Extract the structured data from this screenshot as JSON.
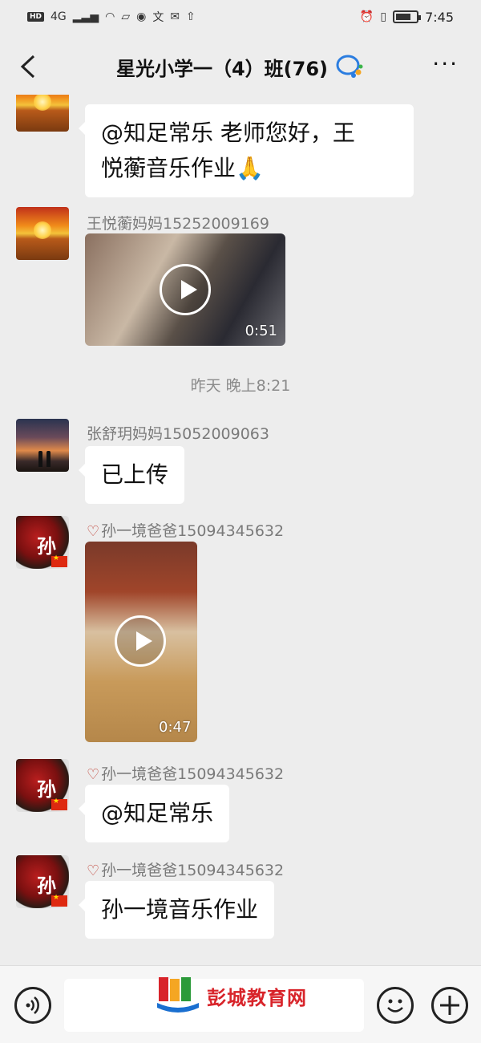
{
  "status_bar": {
    "time": "7:45",
    "network_badge": "HD",
    "network_type": "4G"
  },
  "header": {
    "title": "星光小学一（4）班(76)",
    "more_label": "···"
  },
  "messages": [
    {
      "type": "text",
      "text_lines": [
        "@知足常乐  老师您好，王",
        "悦蘅音乐作业🙏"
      ]
    },
    {
      "type": "video",
      "sender": "王悦蘅妈妈15252009169",
      "duration": "0:51"
    },
    {
      "type": "divider",
      "text": "昨天 晚上8:21"
    },
    {
      "type": "text",
      "sender": "张舒玥妈妈15052009063",
      "text": "已上传"
    },
    {
      "type": "video",
      "sender": "孙一境爸爸15094345632",
      "duration": "0:47",
      "avatar_char": "孙"
    },
    {
      "type": "text",
      "sender": "孙一境爸爸15094345632",
      "text": "@知足常乐",
      "avatar_char": "孙"
    },
    {
      "type": "text",
      "sender": "孙一境爸爸15094345632",
      "text": "孙一境音乐作业",
      "avatar_char": "孙"
    }
  ],
  "input_bar": {
    "placeholder": ""
  },
  "watermark": {
    "text": "彭城教育网"
  },
  "colors": {
    "background": "#ededed",
    "bubble": "#ffffff",
    "wechat_icon": "#c0453a",
    "watermark_text": "#d8242a"
  },
  "icons": [
    "back-arrow-icon",
    "wecom-group-icon",
    "more-icon",
    "play-icon",
    "voice-icon",
    "emoji-icon",
    "plus-icon"
  ]
}
